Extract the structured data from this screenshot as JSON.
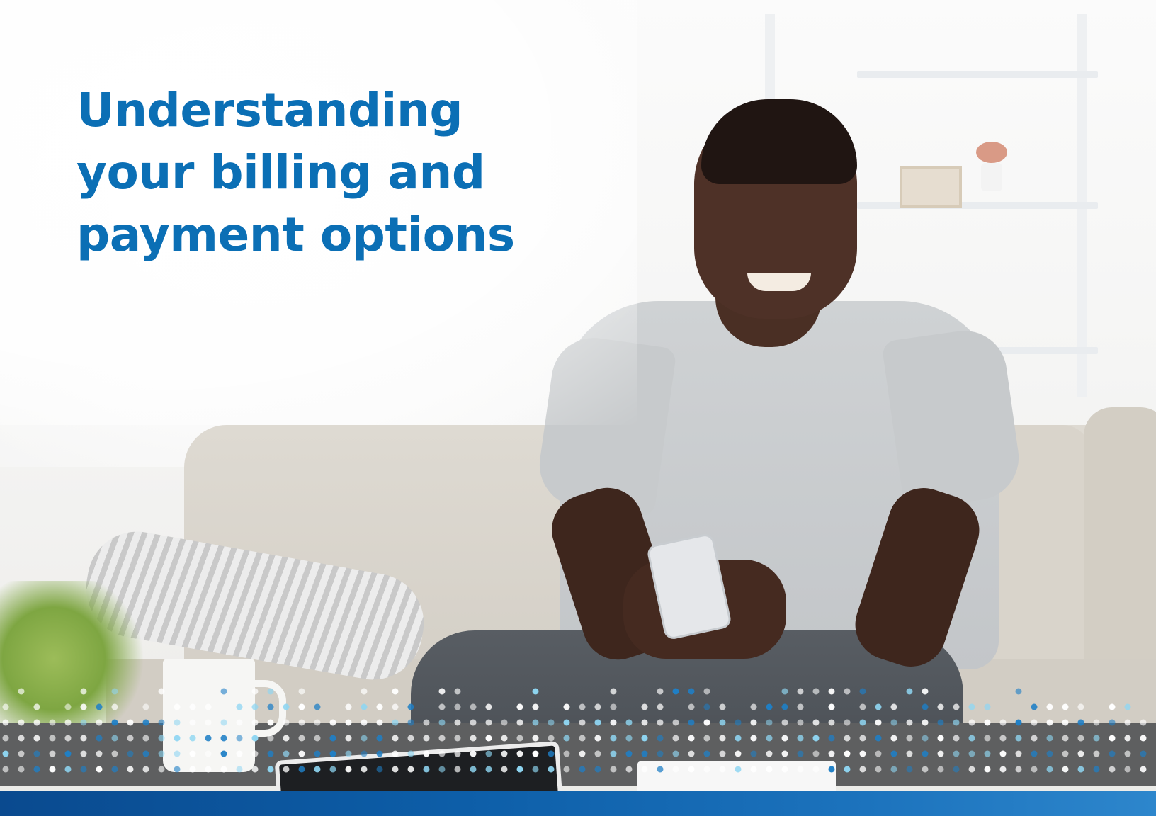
{
  "headline": {
    "lines": [
      "Understanding",
      "your billing and",
      "payment options"
    ]
  },
  "photo": {
    "subject": "smiling man on sofa using phone",
    "icon": "photo-icon"
  },
  "colors": {
    "headline": "#0b6fb5",
    "band": "#0d5ea8",
    "dot_white": "#ffffff",
    "dot_light_blue": "#8fd6f2",
    "dot_blue": "#1f7fc6"
  }
}
